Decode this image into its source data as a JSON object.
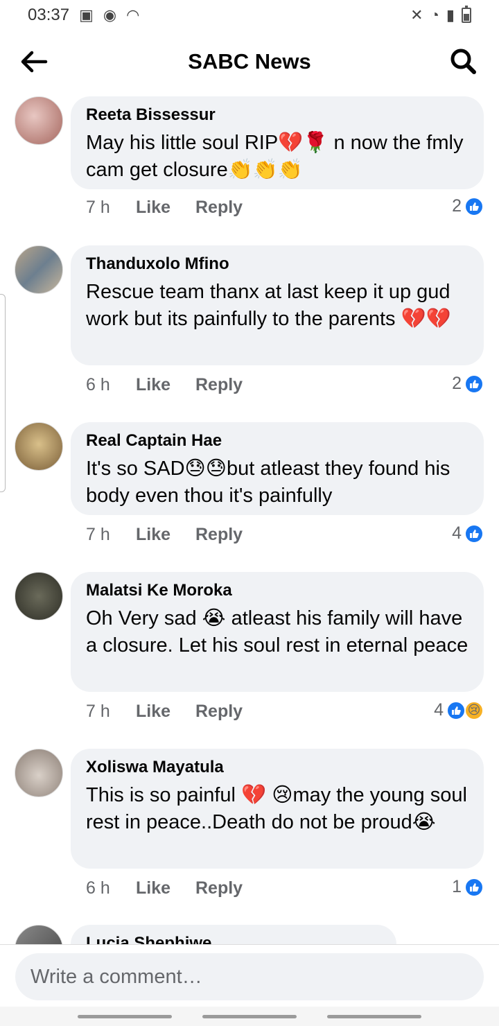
{
  "status_bar": {
    "time": "03:37"
  },
  "header": {
    "title": "SABC News"
  },
  "comments": [
    {
      "author": "Reeta Bissessur",
      "text": "May his little  soul  RIP💔🌹 n now the fmly cam get closure👏👏👏",
      "time": "7 h",
      "like": "Like",
      "reply": "Reply",
      "reaction_count": "2"
    },
    {
      "author": "Thanduxolo Mfino",
      "text": "Rescue team thanx at last keep it up gud work but its painfully to the parents 💔💔",
      "time": "6 h",
      "like": "Like",
      "reply": "Reply",
      "reaction_count": "2"
    },
    {
      "author": "Real Captain Hae",
      "text": "It's so SAD😓😓but atleast they found his body even thou it's painfully",
      "time": "7 h",
      "like": "Like",
      "reply": "Reply",
      "reaction_count": "4"
    },
    {
      "author": "Malatsi Ke Moroka",
      "text": "Oh Very sad 😭 atleast his family will have a closure. Let his soul rest in eternal peace",
      "time": "7 h",
      "like": "Like",
      "reply": "Reply",
      "reaction_count": "4"
    },
    {
      "author": "Xoliswa Mayatula",
      "text": "This is so painful 💔 😢may the young soul rest in peace..Death do not be proud😭",
      "time": "6 h",
      "like": "Like",
      "reply": "Reply",
      "reaction_count": "1"
    },
    {
      "author": "Lucia Shephiwe",
      "text": ""
    }
  ],
  "composer": {
    "placeholder": "Write a comment…"
  },
  "colors": {
    "accent": "#1877f2",
    "bubble": "#f0f2f5",
    "meta_text": "#65676b"
  },
  "icons": [
    "back-arrow-icon",
    "search-icon",
    "like-reaction-icon",
    "sad-reaction-icon"
  ]
}
